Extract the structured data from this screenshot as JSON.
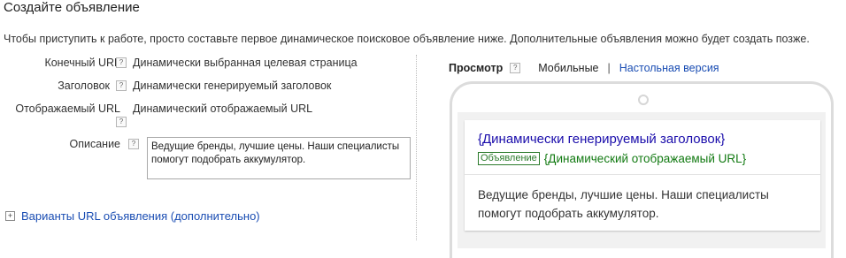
{
  "title": "Создайте объявление",
  "intro": "Чтобы приступить к работе, просто составьте первое динамическое поисковое объявление ниже. Дополнительные объявления можно будет создать позже.",
  "help_glyph": "?",
  "form": {
    "final_url_label": "Конечный URL",
    "final_url_value": "Динамически выбранная целевая страница",
    "headline_label": "Заголовок",
    "headline_value": "Динамически генерируемый заголовок",
    "display_url_label": "Отображаемый URL",
    "display_url_value": "Динамический отображаемый URL",
    "description_label": "Описание",
    "description_value": "Ведущие бренды, лучшие цены. Наши специалисты помогут подобрать аккумулятор."
  },
  "url_variants": {
    "expand_glyph": "+",
    "label": "Варианты URL объявления (дополнительно)"
  },
  "preview": {
    "label": "Просмотр",
    "mobile_label": "Мобильные",
    "separator": "|",
    "desktop_link": "Настольная версия",
    "ad": {
      "headline": "{Динамически генерируемый заголовок}",
      "badge": "Объявление",
      "display_url": "{Динамический отображаемый URL}",
      "description": "Ведущие бренды, лучшие цены. Наши специалисты помогут подобрать аккумулятор."
    }
  },
  "colors": {
    "link": "#1a4db3",
    "ad_headline": "#1a0dab",
    "ad_url": "#127a12"
  }
}
